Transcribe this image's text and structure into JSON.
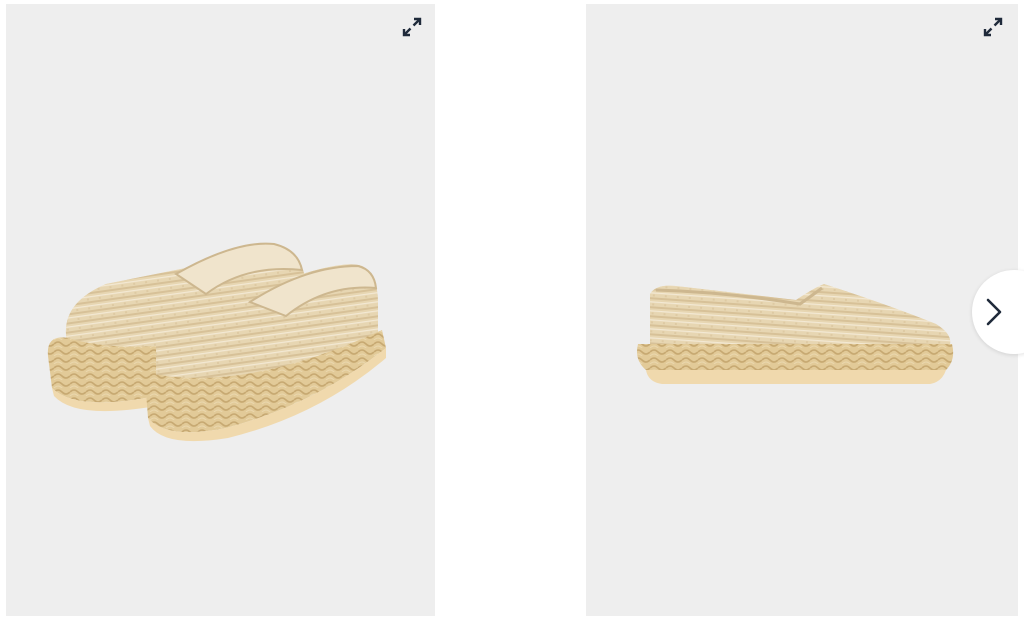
{
  "gallery": {
    "images": [
      {
        "alt": "",
        "view": "pair-angled"
      },
      {
        "alt": "",
        "view": "single-side"
      }
    ],
    "controls": {
      "expand_icon": "expand-arrows-icon",
      "next_icon": "chevron-right-icon"
    }
  },
  "colors": {
    "panel_bg": "#eeeeee",
    "icon": "#1f2a3a",
    "canvas": "#e9d8b4",
    "canvas_stripe": "#d7c199",
    "canvas_sparkle": "#f4ead5",
    "lining": "#efe2c8",
    "jute": "#e2c995",
    "jute_dark": "#c9ad77",
    "sole": "#efd7ac"
  }
}
